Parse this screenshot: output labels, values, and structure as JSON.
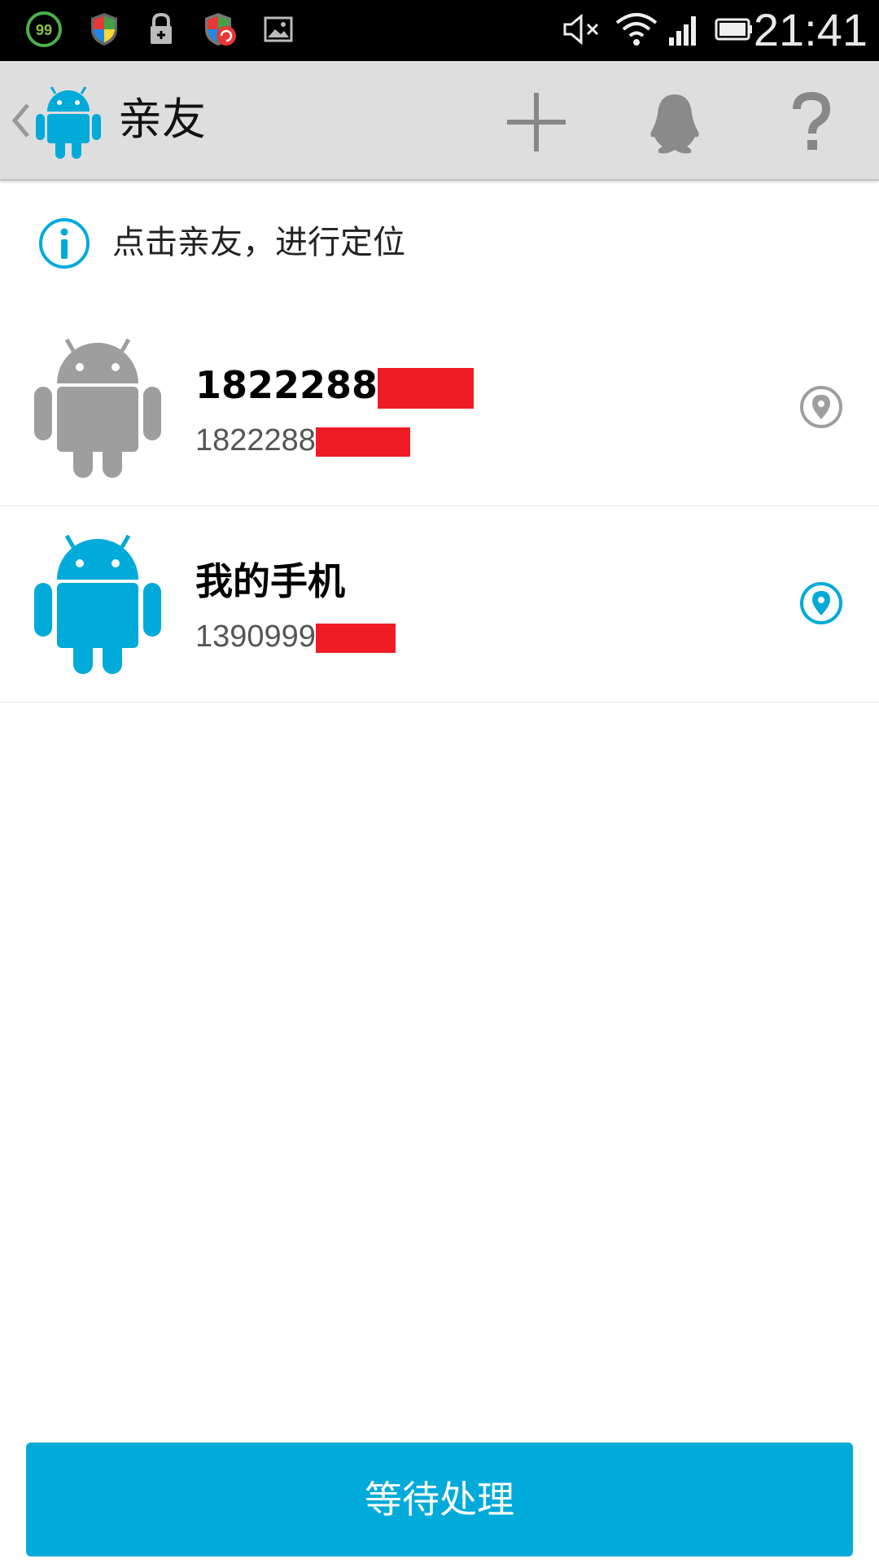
{
  "status_bar": {
    "time": "21:41",
    "badge_count": "99",
    "icons": [
      "battery-saver-icon",
      "shield-icon",
      "lock-icon",
      "sync-shield-icon",
      "image-icon",
      "mute-icon",
      "wifi-icon",
      "signal-icon",
      "battery-icon"
    ]
  },
  "action_bar": {
    "title": "亲友",
    "buttons": [
      "add-icon",
      "qq-icon",
      "help-icon"
    ]
  },
  "hint": {
    "text": "点击亲友，进行定位"
  },
  "contacts": [
    {
      "name": "1822288",
      "number": "1822288",
      "avatar_color": "#9e9e9e",
      "location_color": "#9e9e9e"
    },
    {
      "name": "我的手机",
      "number": "1390999",
      "avatar_color": "#00aad9",
      "location_color": "#00aad9"
    }
  ],
  "bottom_button": {
    "label": "等待处理"
  },
  "colors": {
    "accent": "#00aad9",
    "redaction": "#ef1c26"
  }
}
